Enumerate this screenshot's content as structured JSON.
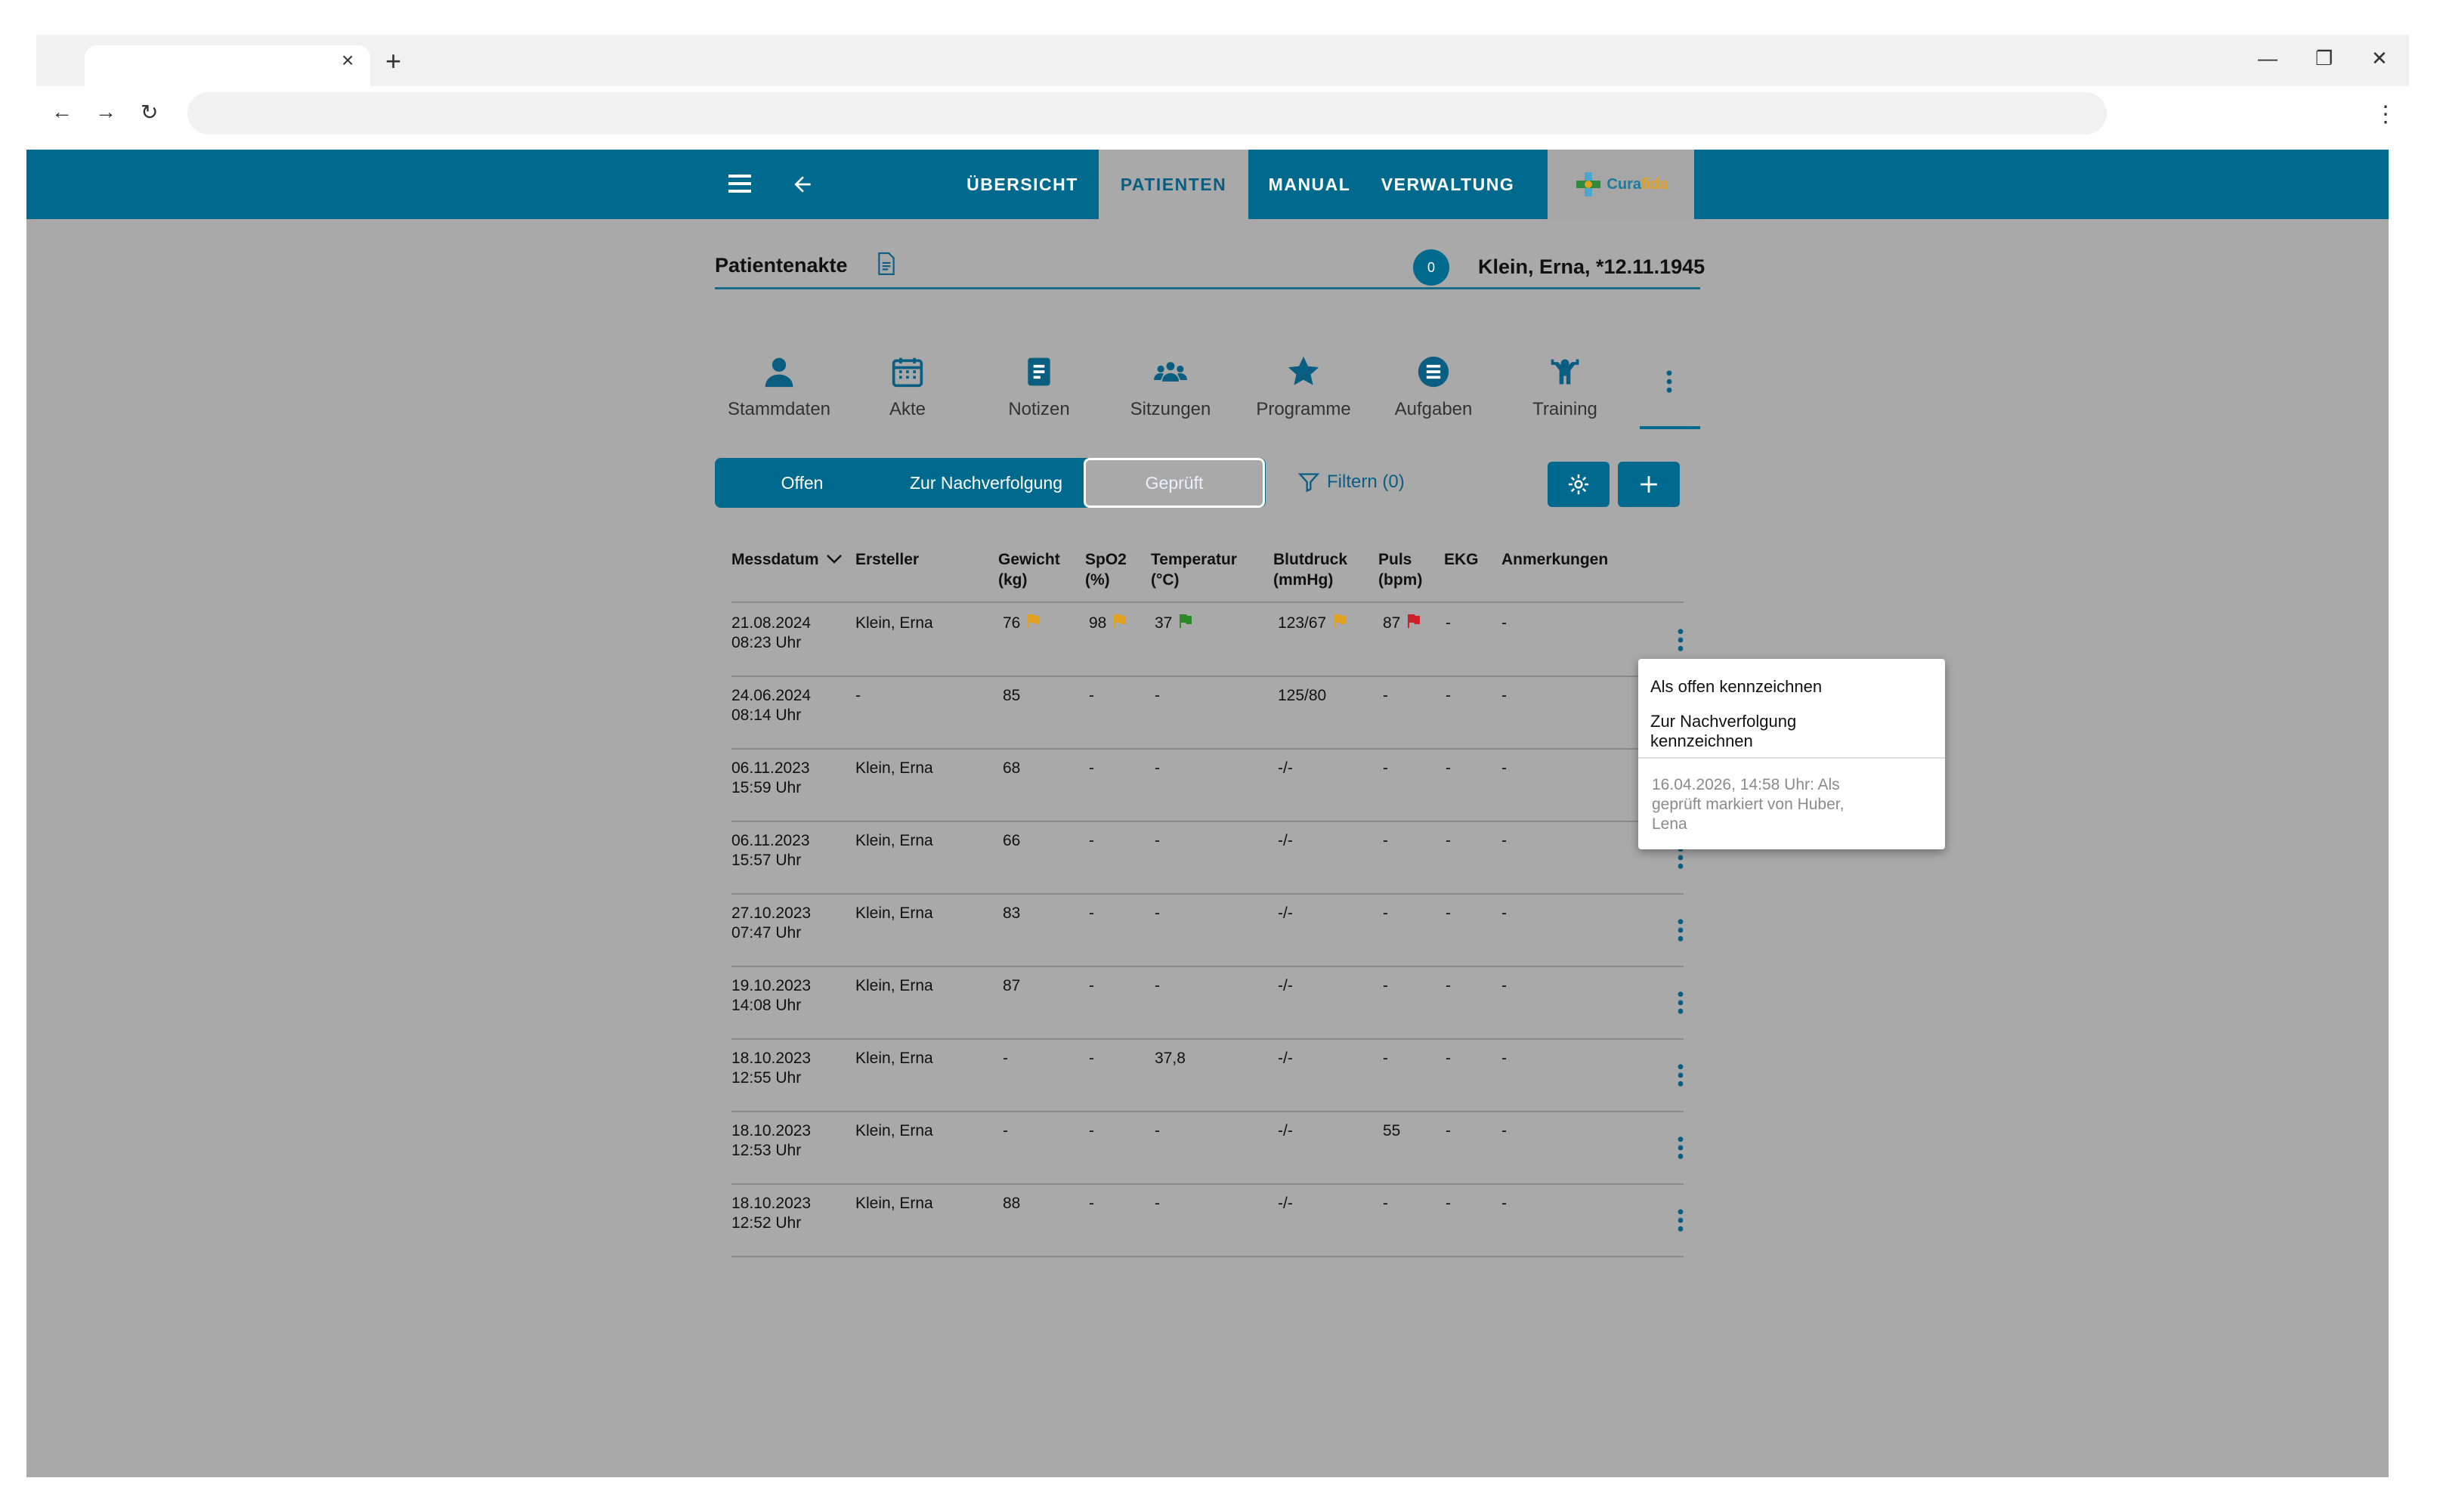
{
  "browser": {
    "tab_close": "×",
    "new_tab": "+",
    "back": "←",
    "forward": "→",
    "reload": "↻",
    "minimize": "—",
    "restore": "❐",
    "close": "✕",
    "menu": "⋮"
  },
  "appbar": {
    "nav_items": [
      "ÜBERSICHT",
      "PATIENTEN",
      "MANUAL",
      "VERWALTUNG"
    ],
    "active_item": "PATIENTEN",
    "logo": {
      "part1": "Cura",
      "part2": "fida"
    },
    "color": "#006a8e"
  },
  "header": {
    "title": "Patientenakte",
    "chat_count": "0",
    "patient": "Klein, Erna, *12.11.1945"
  },
  "section_tabs": [
    {
      "label": "Stammdaten",
      "icon": "person-icon"
    },
    {
      "label": "Akte",
      "icon": "calendar-icon"
    },
    {
      "label": "Notizen",
      "icon": "note-icon"
    },
    {
      "label": "Sitzungen",
      "icon": "group-icon"
    },
    {
      "label": "Programme",
      "icon": "star-icon"
    },
    {
      "label": "Aufgaben",
      "icon": "list-icon"
    },
    {
      "label": "Training",
      "icon": "training-icon"
    }
  ],
  "segment": {
    "offen": "Offen",
    "nachverfolgung": "Zur Nachverfolgung",
    "geprueft": "Geprüft",
    "selected": "Geprüft"
  },
  "filter": {
    "label": "Filtern (0)"
  },
  "table": {
    "headers": [
      {
        "l1": "Messdatum",
        "l2": ""
      },
      {
        "l1": "Ersteller",
        "l2": ""
      },
      {
        "l1": "Gewicht",
        "l2": "(kg)"
      },
      {
        "l1": "SpO2",
        "l2": "(%)"
      },
      {
        "l1": "Temperatur",
        "l2": "(°C)"
      },
      {
        "l1": "Blutdruck",
        "l2": "(mmHg)"
      },
      {
        "l1": "Puls",
        "l2": "(bpm)"
      },
      {
        "l1": "EKG",
        "l2": ""
      },
      {
        "l1": "Anmerkungen",
        "l2": ""
      }
    ],
    "rows": [
      {
        "date": "21.08.2024",
        "time": "08:23 Uhr",
        "creator": "Klein, Erna",
        "weight": "76",
        "spo2": "98",
        "temp": "37",
        "bp": "123/67",
        "pulse": "87",
        "ekg": "-",
        "notes": "-",
        "flags": {
          "weight": "#e0a020",
          "spo2": "#e0a020",
          "temp": "#2a8a2a",
          "bp": "#e0a020",
          "pulse": "#cc1f2a"
        }
      },
      {
        "date": "24.06.2024",
        "time": "08:14 Uhr",
        "creator": "-",
        "weight": "85",
        "spo2": "-",
        "temp": "-",
        "bp": "125/80",
        "pulse": "-",
        "ekg": "-",
        "notes": "-",
        "flags": {}
      },
      {
        "date": "06.11.2023",
        "time": "15:59 Uhr",
        "creator": "Klein, Erna",
        "weight": "68",
        "spo2": "-",
        "temp": "-",
        "bp": "-/-",
        "pulse": "-",
        "ekg": "-",
        "notes": "-",
        "flags": {}
      },
      {
        "date": "06.11.2023",
        "time": "15:57 Uhr",
        "creator": "Klein, Erna",
        "weight": "66",
        "spo2": "-",
        "temp": "-",
        "bp": "-/-",
        "pulse": "-",
        "ekg": "-",
        "notes": "-",
        "flags": {}
      },
      {
        "date": "27.10.2023",
        "time": "07:47 Uhr",
        "creator": "Klein, Erna",
        "weight": "83",
        "spo2": "-",
        "temp": "-",
        "bp": "-/-",
        "pulse": "-",
        "ekg": "-",
        "notes": "-",
        "flags": {}
      },
      {
        "date": "19.10.2023",
        "time": "14:08 Uhr",
        "creator": "Klein, Erna",
        "weight": "87",
        "spo2": "-",
        "temp": "-",
        "bp": "-/-",
        "pulse": "-",
        "ekg": "-",
        "notes": "-",
        "flags": {}
      },
      {
        "date": "18.10.2023",
        "time": "12:55 Uhr",
        "creator": "Klein, Erna",
        "weight": "-",
        "spo2": "-",
        "temp": "37,8",
        "bp": "-/-",
        "pulse": "-",
        "ekg": "-",
        "notes": "-",
        "flags": {}
      },
      {
        "date": "18.10.2023",
        "time": "12:53 Uhr",
        "creator": "Klein, Erna",
        "weight": "-",
        "spo2": "-",
        "temp": "-",
        "bp": "-/-",
        "pulse": "55",
        "ekg": "-",
        "notes": "-",
        "flags": {}
      },
      {
        "date": "18.10.2023",
        "time": "12:52 Uhr",
        "creator": "Klein, Erna",
        "weight": "88",
        "spo2": "-",
        "temp": "-",
        "bp": "-/-",
        "pulse": "-",
        "ekg": "-",
        "notes": "-",
        "flags": {}
      }
    ]
  },
  "context_menu": {
    "item1": "Als offen kennzeichnen",
    "item2_l1": "Zur Nachverfolgung",
    "item2_l2": "kennzeichnen",
    "note_l1": "16.04.2026, 14:58 Uhr: Als",
    "note_l2": "geprüft markiert von Huber,",
    "note_l3": "Lena"
  }
}
